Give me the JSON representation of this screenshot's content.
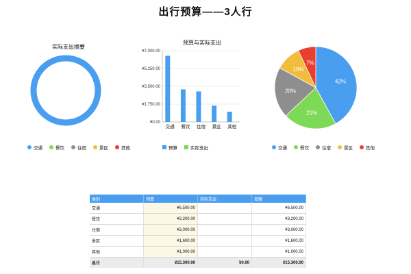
{
  "page_title": "出行预算——3人行",
  "chart_data": [
    {
      "type": "pie",
      "title": "实际支出摘要",
      "categories": [
        "交通",
        "餐饮",
        "住宿",
        "景区",
        "其他"
      ],
      "values": [
        0,
        0,
        0,
        0,
        0
      ],
      "ring_color": "#4a9ef0",
      "legend_position": "bottom"
    },
    {
      "type": "bar",
      "title": "预算与实际支出",
      "categories": [
        "交通",
        "餐饮",
        "住宿",
        "景区",
        "其他"
      ],
      "series": [
        {
          "name": "预算",
          "values": [
            6500,
            3200,
            3000,
            1600,
            1000
          ],
          "color": "#4a9ef0"
        },
        {
          "name": "实际支出",
          "values": [
            0,
            0,
            0,
            0,
            0
          ],
          "color": "#7ed957"
        }
      ],
      "yticks": [
        "¥0.00",
        "¥1,750.00",
        "¥3,500.00",
        "¥5,250.00",
        "¥7,000.00"
      ],
      "ylim": [
        0,
        7000
      ],
      "grid": true,
      "legend_position": "bottom"
    },
    {
      "type": "pie",
      "categories": [
        "交通",
        "餐饮",
        "住宿",
        "景区",
        "其他"
      ],
      "values": [
        42,
        21,
        20,
        10,
        7
      ],
      "labels": [
        "42%",
        "21%",
        "20%",
        "10%",
        "7%"
      ],
      "colors": [
        "#4a9ef0",
        "#7ed957",
        "#8e8e8e",
        "#f2bd3c",
        "#e8402f"
      ],
      "legend_position": "bottom"
    }
  ],
  "table": {
    "headers": [
      "类别",
      "预算",
      "实际支出",
      "差额"
    ],
    "rows": [
      {
        "category": "交通",
        "budget": "¥6,500.00",
        "actual": "",
        "diff": "¥6,500.00"
      },
      {
        "category": "餐饮",
        "budget": "¥3,200.00",
        "actual": "",
        "diff": "¥3,200.00"
      },
      {
        "category": "住宿",
        "budget": "¥3,000.00",
        "actual": "",
        "diff": "¥3,000.00"
      },
      {
        "category": "景区",
        "budget": "¥1,600.00",
        "actual": "",
        "diff": "¥1,600.00"
      },
      {
        "category": "其他",
        "budget": "¥1,000.00",
        "actual": "",
        "diff": "¥1,000.00"
      }
    ],
    "total": {
      "category": "总计",
      "budget": "¥15,300.00",
      "actual": "¥0.00",
      "diff": "¥15,300.00"
    }
  }
}
